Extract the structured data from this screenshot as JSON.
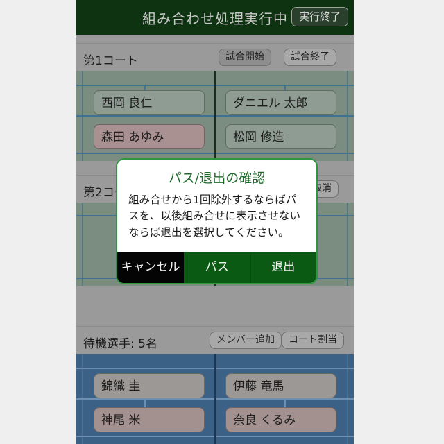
{
  "app": {
    "titlebar": {
      "title": "組み合わせ処理実行中",
      "end_button": "実行終了"
    }
  },
  "courts": [
    {
      "name": "court-1",
      "label": "第1コート",
      "buttons": [
        {
          "name": "match-start-button",
          "label": "試合開始",
          "state": "pressed"
        },
        {
          "name": "match-end-button",
          "label": "試合終了",
          "state": "normal"
        }
      ],
      "surface": "green",
      "players": [
        {
          "name": "西岡 良仁",
          "gender": "m"
        },
        {
          "name": "ダニエル 太郎",
          "gender": "m"
        },
        {
          "name": "森田 あゆみ",
          "gender": "f"
        },
        {
          "name": "松岡 修造",
          "gender": "m"
        }
      ]
    },
    {
      "name": "court-2",
      "label": "第2コート",
      "buttons": [
        {
          "name": "cancel-assign-button",
          "label": "取消",
          "state": "normal"
        }
      ],
      "surface": "green",
      "players": []
    }
  ],
  "waiting": {
    "label": "待機選手: 5名",
    "count": 5,
    "buttons": [
      {
        "name": "add-member-button",
        "label": "メンバー追加"
      },
      {
        "name": "court-assign-button",
        "label": "コート割当"
      }
    ],
    "players": [
      {
        "name": "錦織 圭",
        "gender": "m"
      },
      {
        "name": "伊藤 竜馬",
        "gender": "m"
      },
      {
        "name": "神尾 米",
        "gender": "f"
      },
      {
        "name": "奈良 くるみ",
        "gender": "f"
      }
    ]
  },
  "dialog": {
    "title": "パス/退出の確認",
    "body": "組み合せから1回除外するならばパスを、以後組み合せに表示させないならば退出を選択してください。",
    "buttons": {
      "cancel": "キャンセル",
      "pass": "パス",
      "leave": "退出"
    }
  },
  "colors": {
    "titlebar": "#0d3311",
    "dialog_border": "#2f9640",
    "dialog_title": "#1f6b2b",
    "action_green": "#0b5a14",
    "action_black": "#040404",
    "court_green": "#7b8c81",
    "court_blue": "#3c6186",
    "chip_male": "#8e9c93",
    "chip_female": "#a89190",
    "panel_gray": "#9a9a9a"
  }
}
